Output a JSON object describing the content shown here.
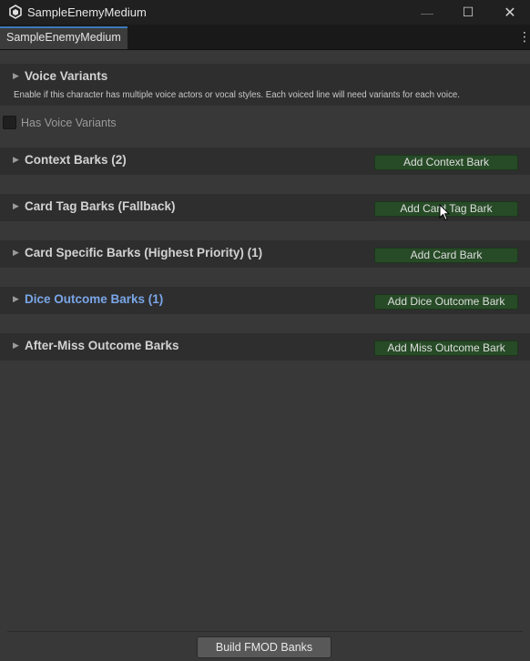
{
  "window": {
    "title": "SampleEnemyMedium",
    "controls": {
      "minimize": "—",
      "maximize": "☐",
      "close": "✕"
    }
  },
  "tab": {
    "label": "SampleEnemyMedium",
    "menu_icon": "⋮"
  },
  "voice": {
    "arrow": "▶",
    "header": "Voice Variants",
    "description": "Enable if this character has multiple voice actors or vocal styles. Each voiced line will need variants for each voice.",
    "checkbox_label": "Has Voice Variants",
    "checked": false
  },
  "sections": [
    {
      "arrow": "▶",
      "header": "Context Barks (2)",
      "button": "Add Context Bark",
      "color": "#d2d2d2"
    },
    {
      "arrow": "▶",
      "header": "Card Tag Barks (Fallback)",
      "button": "Add Card Tag Bark",
      "color": "#d2d2d2"
    },
    {
      "arrow": "▶",
      "header": "Card Specific Barks (Highest Priority) (1)",
      "button": "Add Card Bark",
      "color": "#d2d2d2"
    },
    {
      "arrow": "▶",
      "header": "Dice Outcome Barks (1)",
      "button": "Add Dice Outcome Bark",
      "color": "#7aa6e8"
    },
    {
      "arrow": "▶",
      "header": "After-Miss Outcome Barks",
      "button": "Add Miss Outcome Bark",
      "color": "#d2d2d2"
    }
  ],
  "footer": {
    "build_button": "Build FMOD Banks"
  },
  "colors": {
    "background": "#383838",
    "section_background": "#2e2e2e",
    "green_button": "#274b27",
    "accent_tab": "#3a79bb",
    "highlight_header": "#7aa6e8"
  }
}
